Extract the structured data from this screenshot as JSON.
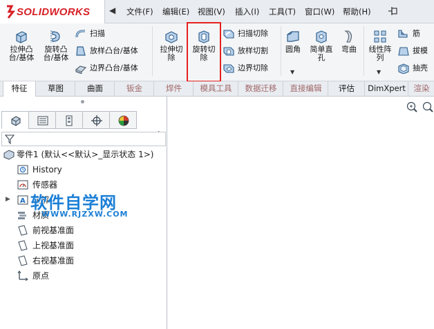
{
  "app": {
    "logo_text": "SOLIDWORKS"
  },
  "menu": {
    "items": [
      "文件(F)",
      "编辑(E)",
      "视图(V)",
      "插入(I)",
      "工具(T)",
      "窗口(W)",
      "帮助(H)"
    ]
  },
  "ribbon": {
    "extrude_boss": "拉伸凸\n台/基体",
    "revolve_boss": "旋转凸\n台/基体",
    "sweep": "扫描",
    "loft_boss": "放样凸台/基体",
    "boundary_boss": "边界凸台/基体",
    "extrude_cut": "拉伸切\n除",
    "revolve_cut": "旋转切\n除",
    "sweep_cut": "扫描切除",
    "loft_cut": "放样切割",
    "boundary_cut": "边界切除",
    "fillet": "圆角",
    "simple_hole": "简单直\n孔",
    "flex": "弯曲",
    "linear_pattern": "线性阵\n列",
    "rib": "筋",
    "draft": "拔模",
    "shell": "抽壳"
  },
  "tabs": [
    {
      "label": "特征",
      "active": true
    },
    {
      "label": "草图"
    },
    {
      "label": "曲面"
    },
    {
      "label": "钣金"
    },
    {
      "label": "焊件"
    },
    {
      "label": "模具工具"
    },
    {
      "label": "数据迁移"
    },
    {
      "label": "直接编辑"
    },
    {
      "label": "评估"
    },
    {
      "label": "DimXpert"
    },
    {
      "label": "渲染"
    }
  ],
  "tree": {
    "root": "零件1  (默认<<默认>_显示状态 1>)",
    "items": [
      "History",
      "传感器",
      "注解",
      "材质",
      "前视基准面",
      "上视基准面",
      "右视基准面",
      "原点"
    ]
  },
  "watermark": {
    "cn": "软件自学网",
    "en": "WWW.RJZXW.COM"
  },
  "colors": {
    "accent_red": "#e5201c",
    "logo_red": "#d71f26",
    "watermark_blue": "#1b7fd6"
  }
}
